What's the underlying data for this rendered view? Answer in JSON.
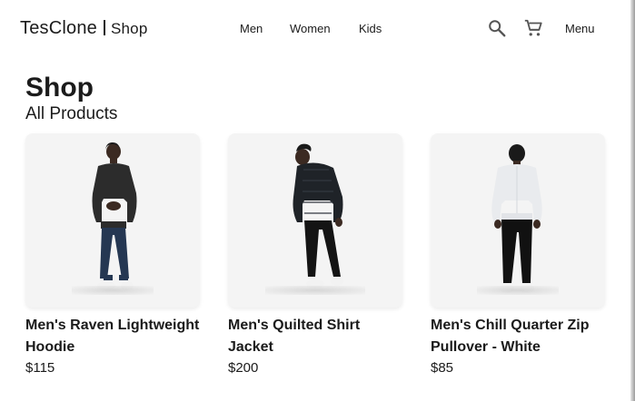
{
  "header": {
    "brand": "TesClone",
    "brand_sub": "Shop",
    "nav": [
      "Men",
      "Women",
      "Kids"
    ],
    "menu_label": "Menu"
  },
  "page": {
    "title": "Shop",
    "subtitle": "All Products"
  },
  "products": [
    {
      "name": "Men's Raven Lightweight Hoodie",
      "price": "$115"
    },
    {
      "name": "Men's Quilted Shirt Jacket",
      "price": "$200"
    },
    {
      "name": "Men's Chill Quarter Zip Pullover - White",
      "price": "$85"
    }
  ],
  "icons": {
    "search": "search-icon",
    "cart": "shopping-cart-icon"
  },
  "colors": {
    "text": "#1b1b1b",
    "card_bg": "#f4f4f4"
  }
}
